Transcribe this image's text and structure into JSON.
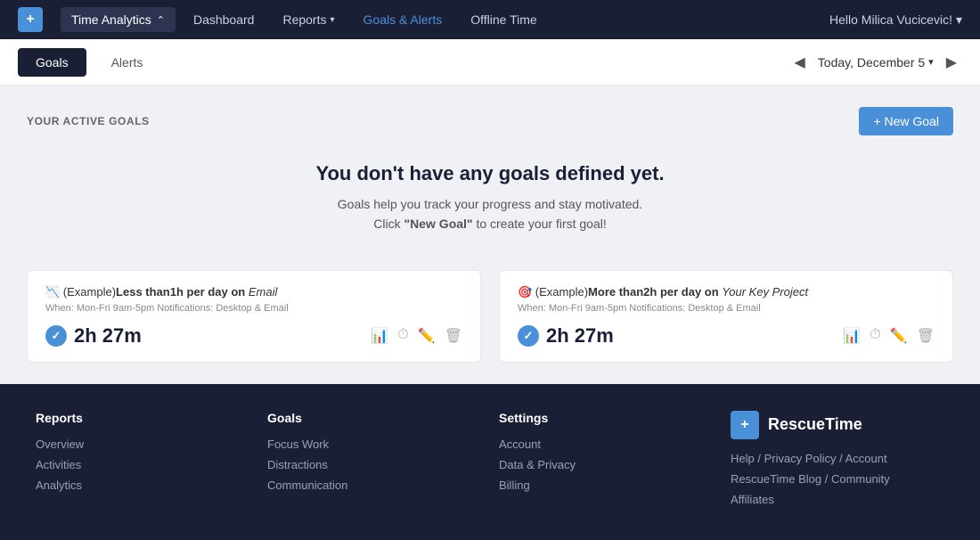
{
  "topnav": {
    "logo_symbol": "+",
    "app_name": "Time Analytics",
    "app_name_chevron": "⌃",
    "nav_items": [
      {
        "label": "Dashboard",
        "active": false
      },
      {
        "label": "Reports",
        "active": false,
        "has_dropdown": true
      },
      {
        "label": "Goals & Alerts",
        "active": true
      },
      {
        "label": "Offline Time",
        "active": false
      }
    ],
    "user_greeting": "Hello Milica Vucicevic!",
    "user_chevron": "▾"
  },
  "subnav": {
    "tabs": [
      {
        "label": "Goals",
        "active": true
      },
      {
        "label": "Alerts",
        "active": false
      }
    ],
    "date_prev": "◀",
    "date_label": "Today, December 5",
    "date_chevron": "▾",
    "date_next": "▶"
  },
  "main": {
    "section_title": "YOUR ACTIVE GOALS",
    "new_goal_label": "+ New Goal",
    "empty_heading": "You don't have any goals defined yet.",
    "empty_sub1": "Goals help you track your progress and stay motivated.",
    "empty_sub2_prefix": "Click ",
    "empty_sub2_bold": "\"New Goal\"",
    "empty_sub2_suffix": " to create your first goal!",
    "example_cards": [
      {
        "icon": "📉",
        "title_prefix": "(Example)",
        "title_main": "Less than1h per day on",
        "title_em": "Email",
        "subtitle": "When: Mon-Fri 9am-5pm Notifications: Desktop & Email",
        "time": "2h 27m"
      },
      {
        "icon": "🎯",
        "title_prefix": "(Example)",
        "title_main": "More than2h per day on",
        "title_em": "Your Key Project",
        "subtitle": "When: Mon-Fri 9am-5pm Notifications: Desktop & Email",
        "time": "2h 27m"
      }
    ]
  },
  "footer": {
    "cols": [
      {
        "heading": "Reports",
        "links": [
          "Overview",
          "Activities",
          "Analytics"
        ]
      },
      {
        "heading": "Goals",
        "links": [
          "Focus Work",
          "Distractions",
          "Communication"
        ]
      },
      {
        "heading": "Settings",
        "links": [
          "Account",
          "Data & Privacy",
          "Billing"
        ]
      }
    ],
    "brand": {
      "logo_symbol": "+",
      "name": "RescueTime"
    },
    "help_links": [
      "Help / Privacy Policy / Account",
      "RescueTime Blog / Community",
      "Affiliates"
    ]
  }
}
